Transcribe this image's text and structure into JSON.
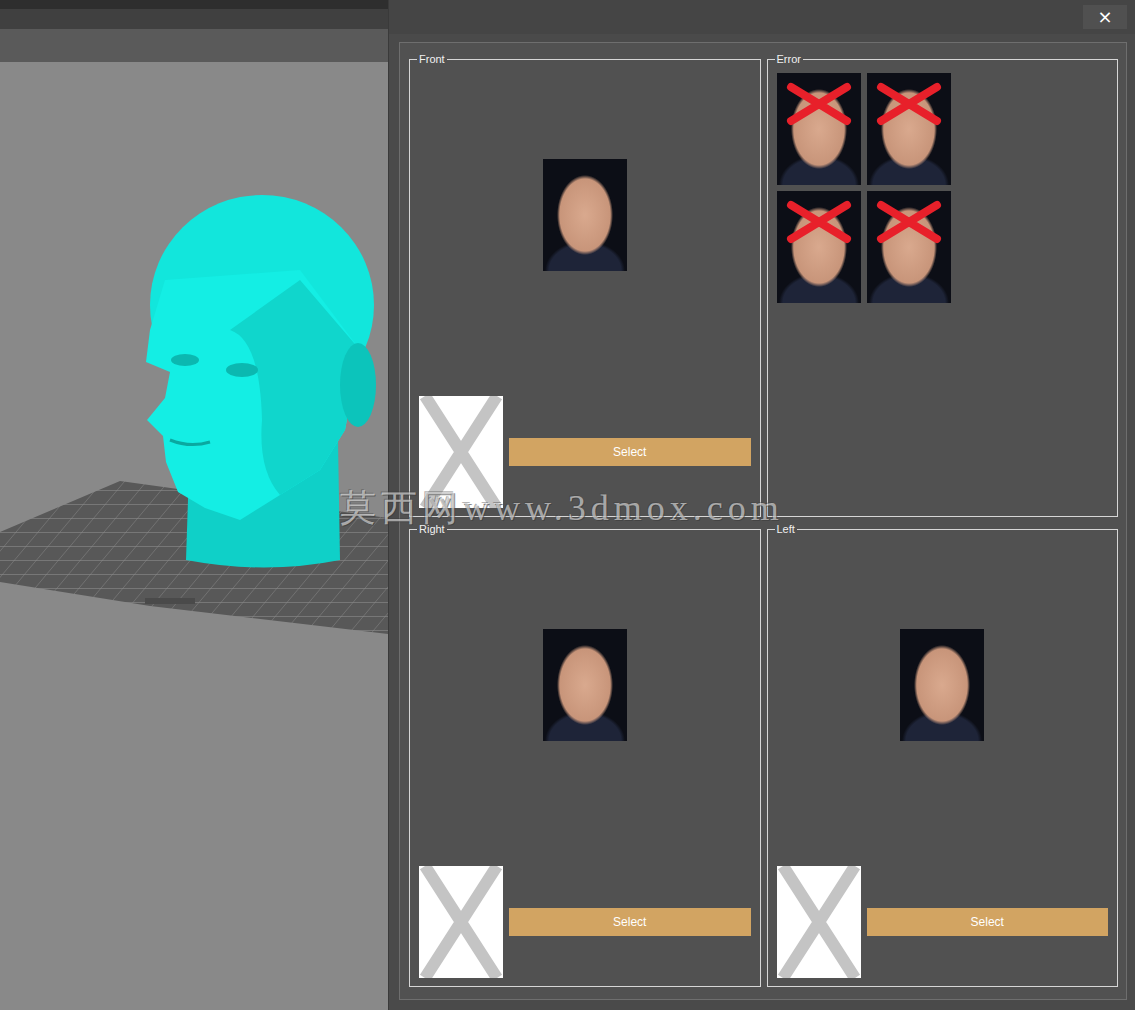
{
  "window": {
    "close": "×"
  },
  "watermark": "莫西网www.3dmox.com",
  "groups": [
    {
      "kind": "slot",
      "title": "Front",
      "button": "Select"
    },
    {
      "kind": "error",
      "title": "Error",
      "examples": [
        {
          "crossed": true
        },
        {
          "crossed": true
        },
        {
          "crossed": true
        },
        {
          "crossed": true
        }
      ]
    },
    {
      "kind": "slot",
      "title": "Right",
      "button": "Select"
    },
    {
      "kind": "slot",
      "title": "Left",
      "button": "Select"
    }
  ]
}
